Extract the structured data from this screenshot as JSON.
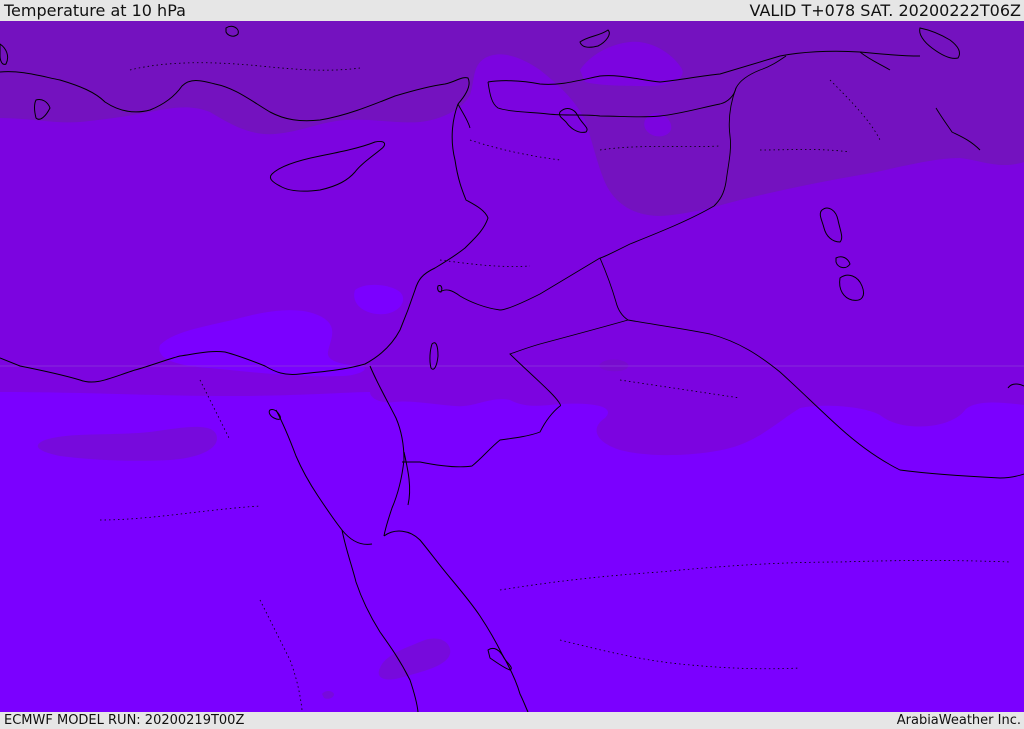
{
  "header": {
    "title": "Temperature at 10 hPa",
    "valid_time": "VALID T+078 SAT. 20200222T06Z"
  },
  "footer": {
    "model_run": "ECMWF MODEL RUN: 20200219T00Z",
    "credit": "ArabiaWeather Inc."
  },
  "map": {
    "colors": {
      "dark_band": "#7412bf",
      "mid_band": "#7c04e0",
      "light_band": "#7b00ff",
      "lighter_patch": "#7c0cff",
      "coastline": "#000000"
    }
  }
}
